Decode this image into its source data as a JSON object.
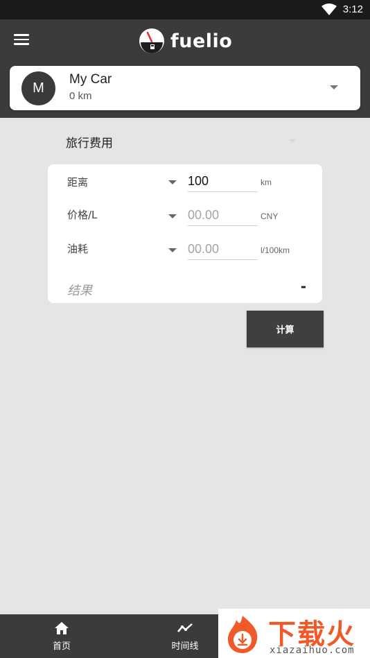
{
  "status_bar": {
    "time": "3:12",
    "wifi_icon": "wifi-icon"
  },
  "app_bar": {
    "menu_icon": "hamburger-menu-icon",
    "logo_icon": "fuel-gauge-icon",
    "brand": "fuelio"
  },
  "car": {
    "avatar_letter": "M",
    "name": "My Car",
    "odometer": "0 km",
    "dropdown_icon": "chevron-down-icon"
  },
  "section": {
    "title": "旅行费用"
  },
  "calculator": {
    "rows": [
      {
        "label": "距离",
        "value": "100",
        "placeholder": "",
        "unit": "km"
      },
      {
        "label": "价格/L",
        "value": "",
        "placeholder": "00.00",
        "unit": "CNY"
      },
      {
        "label": "油耗",
        "value": "",
        "placeholder": "00.00",
        "unit": "l/100km"
      }
    ],
    "result_label": "结果",
    "result_value": "-",
    "button_label": "计算"
  },
  "bottom_nav": [
    {
      "label": "首页",
      "icon": "home-icon"
    },
    {
      "label": "时间线",
      "icon": "timeline-icon"
    }
  ],
  "watermark": {
    "text": "下载火",
    "sub": "xiazaihuo.com"
  },
  "colors": {
    "app_bar": "#3b3b3b",
    "background": "#e5e5e5",
    "button": "#3f3f3f",
    "watermark_accent": "#f05a28"
  }
}
